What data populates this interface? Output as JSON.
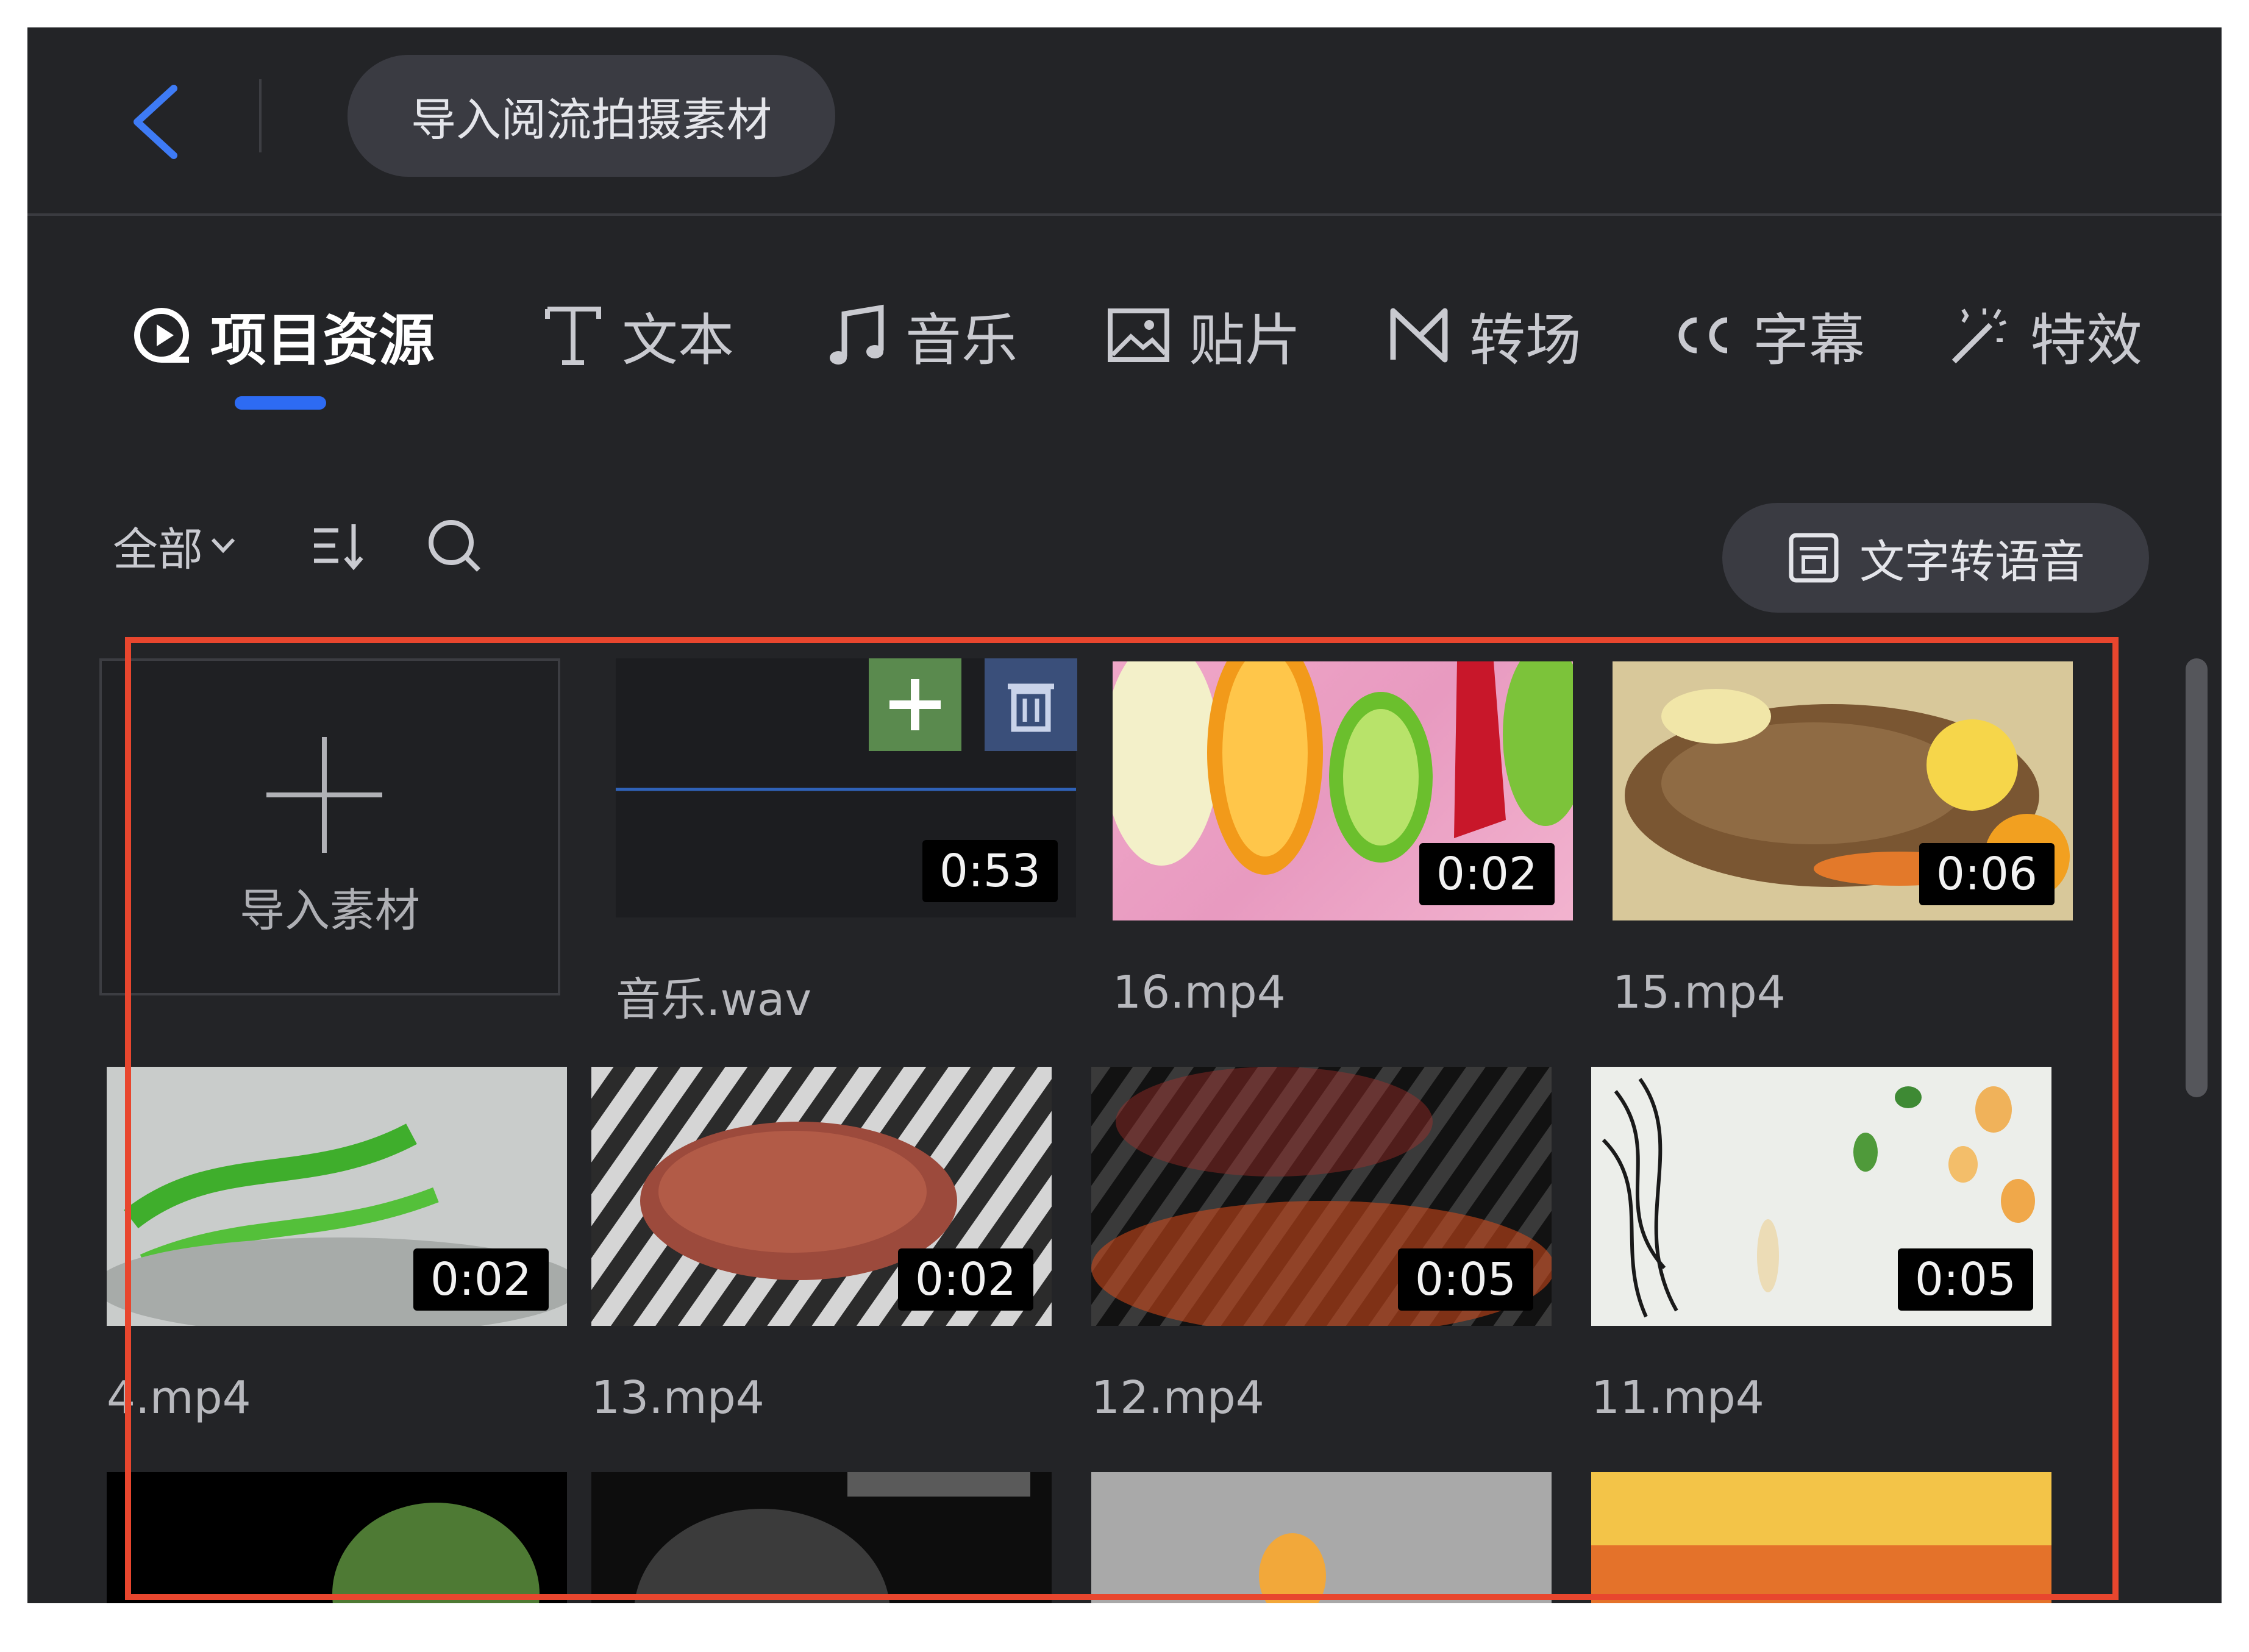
{
  "header": {
    "import_button": "导入阅流拍摄素材"
  },
  "tabs": [
    {
      "label": "项目资源",
      "icon": "play-circle-icon",
      "active": true
    },
    {
      "label": "文本",
      "icon": "text-t-icon",
      "active": false
    },
    {
      "label": "音乐",
      "icon": "music-note-icon",
      "active": false
    },
    {
      "label": "贴片",
      "icon": "image-icon",
      "active": false
    },
    {
      "label": "转场",
      "icon": "transition-icon",
      "active": false
    },
    {
      "label": "字幕",
      "icon": "cc-icon",
      "active": false
    },
    {
      "label": "特效",
      "icon": "magic-wand-icon",
      "active": false
    }
  ],
  "toolbar": {
    "filter_label": "全部",
    "tts_label": "文字转语音"
  },
  "import_card": {
    "label": "导入素材"
  },
  "media": [
    {
      "name": "音乐.wav",
      "duration": "0:53"
    },
    {
      "name": "16.mp4",
      "duration": "0:02"
    },
    {
      "name": "15.mp4",
      "duration": "0:06"
    },
    {
      "name": "4.mp4",
      "duration": "0:02"
    },
    {
      "name": "13.mp4",
      "duration": "0:02"
    },
    {
      "name": "12.mp4",
      "duration": "0:05"
    },
    {
      "name": "11.mp4",
      "duration": "0:05"
    }
  ],
  "colors": {
    "background": "#232427",
    "accent": "#2d6bf3",
    "highlight_border": "#e8462e",
    "add_button": "#5a8a4e",
    "delete_button": "#3a4f7a"
  }
}
